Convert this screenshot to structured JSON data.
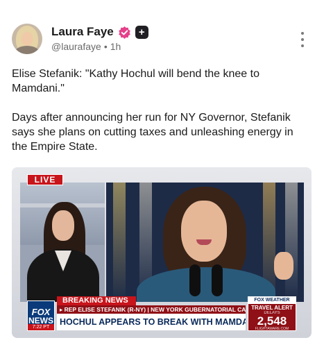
{
  "author": {
    "display_name": "Laura Faye",
    "handle": "@laurafaye",
    "separator": "•",
    "time_ago": "1h",
    "verified_color": "#e5418a",
    "plus_label": "+"
  },
  "post": {
    "paragraph_1": "Elise Stefanik: \"Kathy Hochul will bend the knee to Mamdani.\"",
    "paragraph_2": "Days after announcing her run for NY Governor, Stefanik says she plans on cutting taxes and unleashing energy in the Empire State."
  },
  "media": {
    "live_label": "LIVE",
    "breaking_label": "BREAKING NEWS",
    "subhead": "▸ REP ELISE STEFANIK (R-NY) | NEW YORK GUBERNATORIAL CANDIDATE",
    "headline": "HOCHUL APPEARS TO BREAK WITH MAMDANI ON BUSES",
    "network_top": "FOX",
    "network_bottom": "NEWS",
    "clock": "7:22 PT",
    "weather": {
      "brand": "FOX WEATHER",
      "alert": "TRAVEL ALERT",
      "alert_sub": "DELAYS",
      "count": "2,548",
      "site": "FLIGHTAWARE.COM"
    }
  },
  "icons": {
    "verified": "verified-badge-icon",
    "plus": "plus-badge-icon",
    "more": "more-vertical-icon"
  }
}
